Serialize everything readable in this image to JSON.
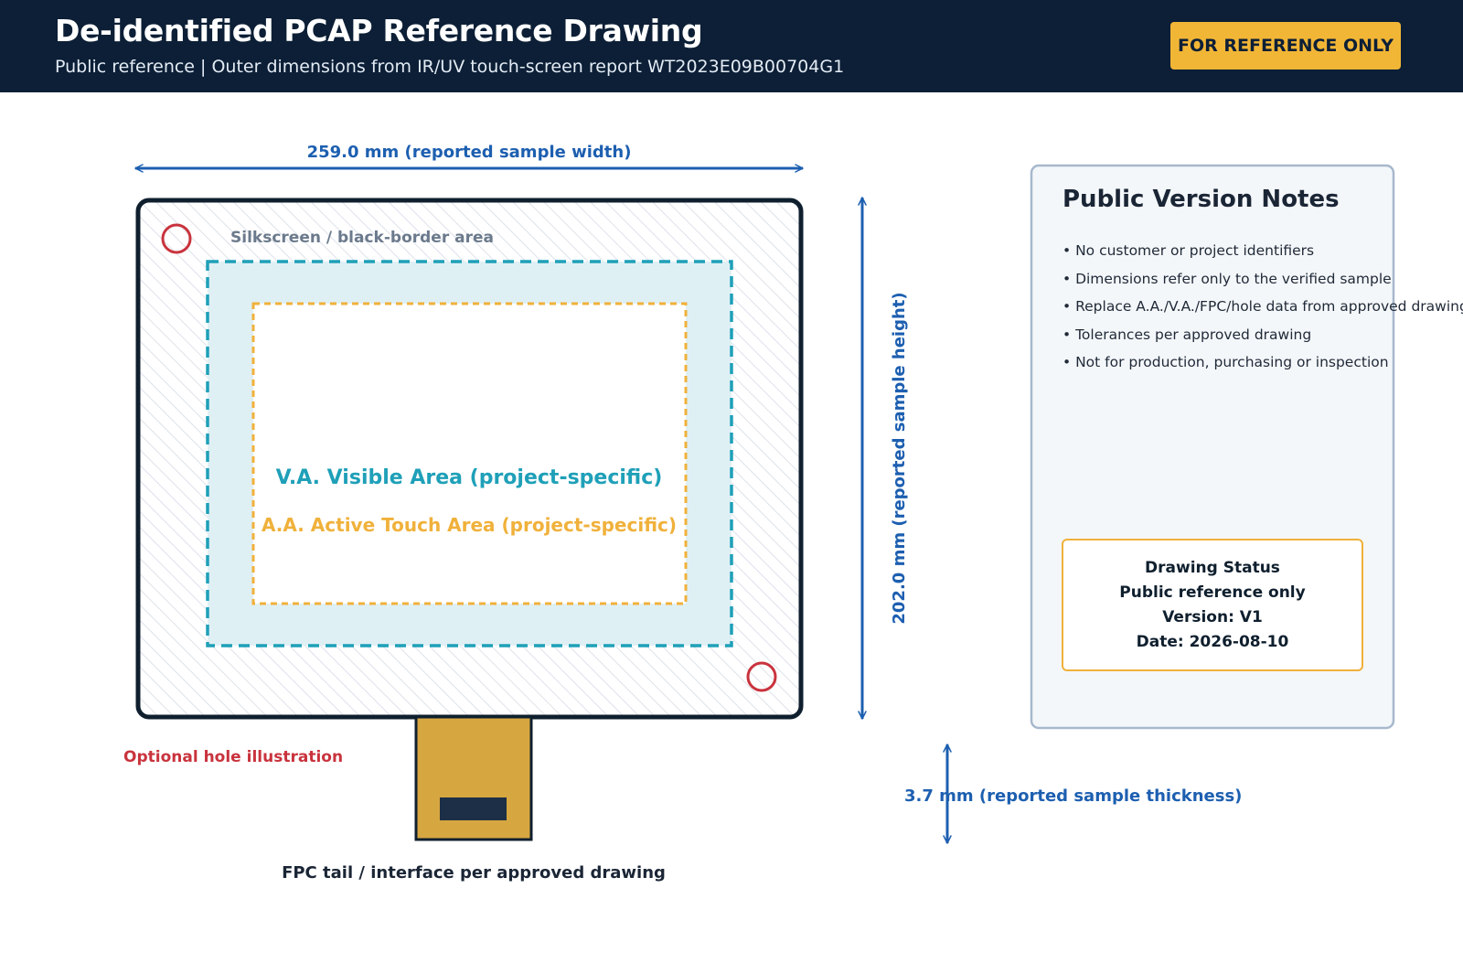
{
  "header": {
    "title": "De-identified PCAP Reference Drawing",
    "subtitle": "Public reference | Outer dimensions from IR/UV touch-screen report WT2023E09B00704G1",
    "badge": "FOR REFERENCE ONLY"
  },
  "drawing": {
    "width_label": "259.0 mm (reported sample width)",
    "height_label": "202.0 mm (reported sample height)",
    "thickness_label": "3.7 mm (reported sample thickness)",
    "silkscreen_label": "Silkscreen / black-border area",
    "va_label": "V.A. Visible Area (project-specific)",
    "aa_label": "A.A. Active Touch Area (project-specific)",
    "hole_label": "Optional hole illustration",
    "fpc_label": "FPC tail / interface per approved drawing"
  },
  "notes": {
    "title": "Public Version Notes",
    "items": [
      "• No customer or project identifiers",
      "• Dimensions refer only to the verified sample",
      "• Replace A.A./V.A./FPC/hole data from approved drawing",
      "• Tolerances per approved drawing",
      "• Not for production, purchasing or inspection"
    ]
  },
  "status": {
    "heading": "Drawing Status",
    "line1": "Public reference only",
    "line2": "Version: V1",
    "line3": "Date: 2026-08-10"
  },
  "colors": {
    "header_bg": "#0c1f36",
    "badge_bg": "#f2b636",
    "dimension_blue": "#1d5fb0",
    "va_teal": "#1fa0b8",
    "aa_orange": "#f0b13b",
    "hole_red": "#c9333d",
    "fpc_gold": "#d6a640"
  }
}
